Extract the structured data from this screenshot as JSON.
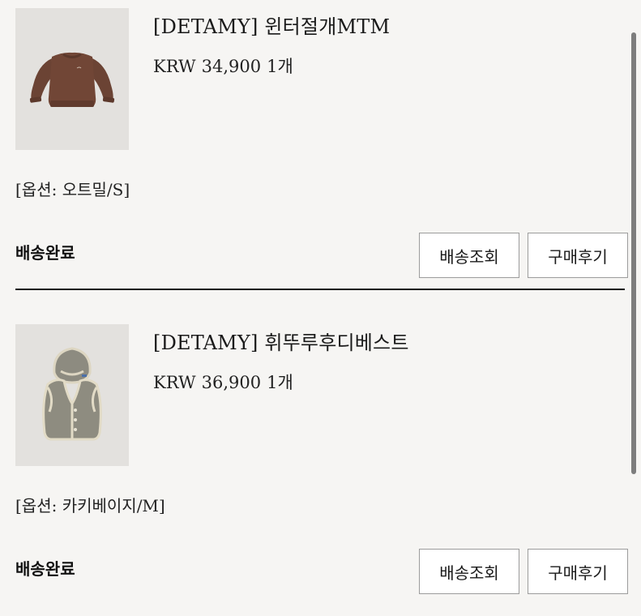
{
  "orders": [
    {
      "product_name": "[DETAMY] 윈터절개MTM",
      "currency": "KRW",
      "price": "34,900",
      "quantity": "1개",
      "option": "[옵션: 오트밀/S]",
      "status": "배송완료",
      "track_label": "배송조회",
      "review_label": "구매후기",
      "thumb_icon": "brown-sweatshirt-image"
    },
    {
      "product_name": "[DETAMY] 휘뚜루후디베스트",
      "currency": "KRW",
      "price": "36,900",
      "quantity": "1개",
      "option": "[옵션: 카키베이지/M]",
      "status": "배송완료",
      "track_label": "배송조회",
      "review_label": "구매후기",
      "thumb_icon": "hooded-vest-image"
    }
  ],
  "colors": {
    "background": "#f6f5f3",
    "thumb_background": "#e3e1de",
    "divider": "#111111",
    "button_border": "#9c9c9c"
  }
}
